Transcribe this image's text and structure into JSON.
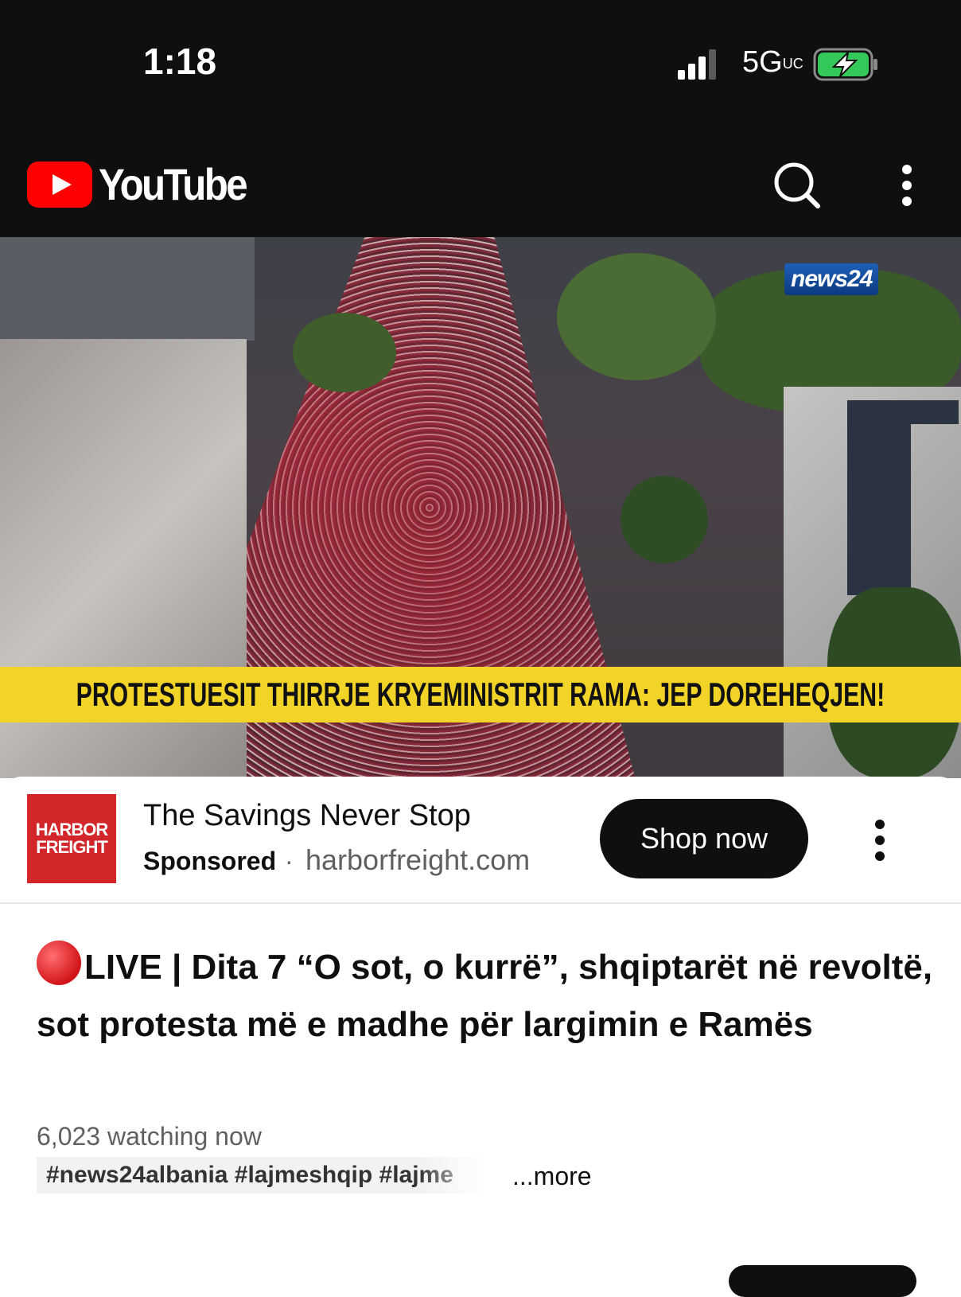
{
  "status_bar": {
    "time": "1:18",
    "network": "5G",
    "network_sub": "UC"
  },
  "app": {
    "name": "YouTube"
  },
  "video": {
    "channel_watermark": "news24",
    "caption": "PROTESTUESIT THIRRJE KRYEMINISTRIT RAMA: JEP DOREHEQJEN!"
  },
  "ad": {
    "logo_line1": "HARBOR",
    "logo_line2": "FREIGHT",
    "title": "The Savings Never Stop",
    "sponsored": "Sponsored",
    "separator": "·",
    "domain": "harborfreight.com",
    "cta": "Shop now"
  },
  "info": {
    "title": "LIVE | Dita 7 “O sot, o kurrë”, shqiptarët në revoltë, sot protesta më e madhe për largimin e Ramës",
    "watching": "6,023 watching now",
    "tags": "#news24albania #lajmeshqip #lajme",
    "more": "...more"
  },
  "colors": {
    "brand_red": "#ff0000",
    "ad_red": "#d3262b",
    "caption_yellow": "#f2d327",
    "dark": "#0f0f0f"
  }
}
